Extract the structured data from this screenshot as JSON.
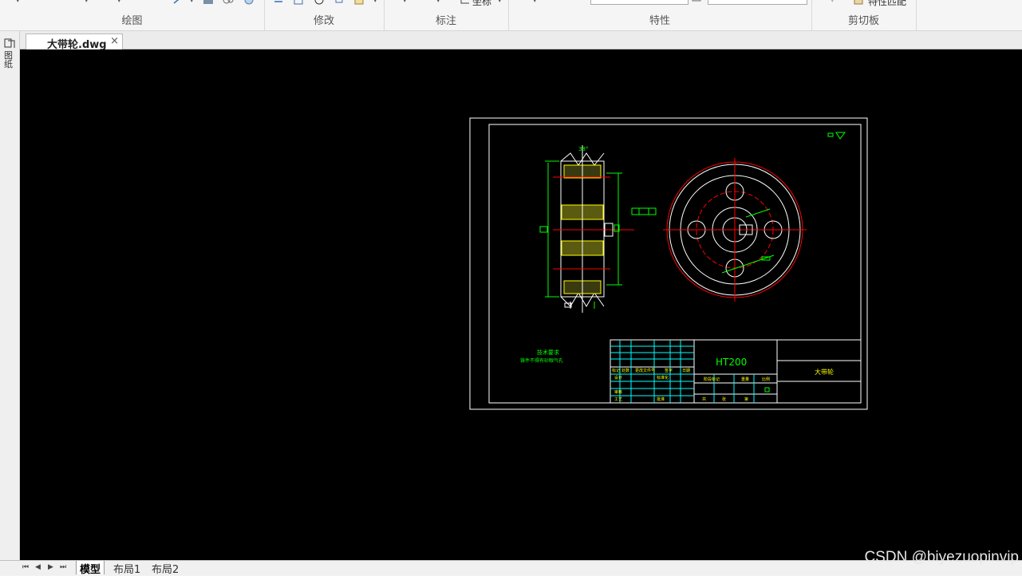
{
  "ribbon": {
    "groups": [
      {
        "label": "绘图"
      },
      {
        "label": "修改"
      },
      {
        "label": "标注"
      },
      {
        "label": "特性"
      },
      {
        "label": "剪切板"
      }
    ],
    "coords_label": "坐标",
    "match_props_label": "特性匹配"
  },
  "document_tab": {
    "label": "大带轮.dwg",
    "close": "×"
  },
  "left_palette": {
    "label": "图纸"
  },
  "layout_tabs": [
    "模型",
    "布局1",
    "布局2"
  ],
  "layout_nav": [
    "⏮",
    "◀",
    "▶",
    "⏭"
  ],
  "drawing": {
    "material": "HT200",
    "part_name": "大带轮",
    "tech_req_title": "技术要求",
    "tech_req_text": "铸件不得有砂眼气孔",
    "taper_angle": "38°",
    "title_block_rows": [
      "标记",
      "处数",
      "更改文件号",
      "签字",
      "日期",
      "设计",
      "标准化",
      "审核",
      "工艺",
      "批准",
      "阶段标记",
      "重量",
      "比例",
      "共",
      "张",
      "第"
    ]
  },
  "colors": {
    "canvas": "#000000",
    "line_white": "#ffffff",
    "line_green": "#00ff00",
    "line_yellow": "#ffff00",
    "line_red": "#ff0000",
    "line_cyan": "#00ffff"
  },
  "watermark": "CSDN @biyezuopinvip"
}
